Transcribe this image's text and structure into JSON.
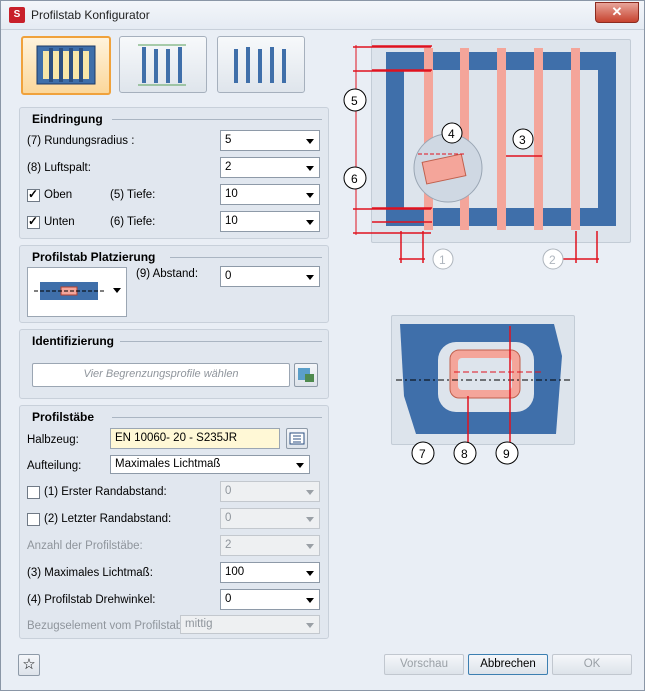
{
  "window": {
    "title": "Profilstab Konfigurator",
    "close": "✕"
  },
  "eindringung": {
    "title": "Eindringung",
    "radius_label": "(7) Rundungsradius :",
    "radius_value": "5",
    "gap_label": "(8) Luftspalt:",
    "gap_value": "2",
    "top_label": "Oben",
    "top_depth_label": "(5) Tiefe:",
    "top_depth_value": "10",
    "bottom_label": "Unten",
    "bottom_depth_label": "(6) Tiefe:",
    "bottom_depth_value": "10"
  },
  "platzierung": {
    "title": "Profilstab Platzierung",
    "distance_label": "(9) Abstand:",
    "distance_value": "0"
  },
  "identifizierung": {
    "title": "Identifizierung",
    "placeholder": "Vier Begrenzungsprofile wählen"
  },
  "profilstaebe": {
    "title": "Profilstäbe",
    "halbzeug_label": "Halbzeug:",
    "halbzeug_value": "EN 10060- 20 - S235JR",
    "aufteilung_label": "Aufteilung:",
    "aufteilung_value": "Maximales Lichtmaß",
    "first_edge_label": "(1) Erster Randabstand:",
    "first_edge_value": "0",
    "last_edge_label": "(2) Letzter Randabstand:",
    "last_edge_value": "0",
    "count_label": "Anzahl der Profilstäbe:",
    "count_value": "2",
    "max_gap_label": "(3) Maximales Lichtmaß:",
    "max_gap_value": "100",
    "rotation_label": "(4) Profilstab Drehwinkel:",
    "rotation_value": "0",
    "reference_label": "Bezugselement vom Profilstab:",
    "reference_value": "mittig"
  },
  "callouts": {
    "c1": "1",
    "c2": "2",
    "c3": "3",
    "c4": "4",
    "c5": "5",
    "c6": "6",
    "c7": "7",
    "c8": "8",
    "c9": "9"
  },
  "footer": {
    "favorite": "☆",
    "preview": "Vorschau",
    "cancel": "Abbrechen",
    "ok": "OK"
  },
  "colors": {
    "frame": "#3f6faa",
    "bar": "#f4a59a",
    "dimension": "#e0121e",
    "accent": "#f0a23c"
  }
}
